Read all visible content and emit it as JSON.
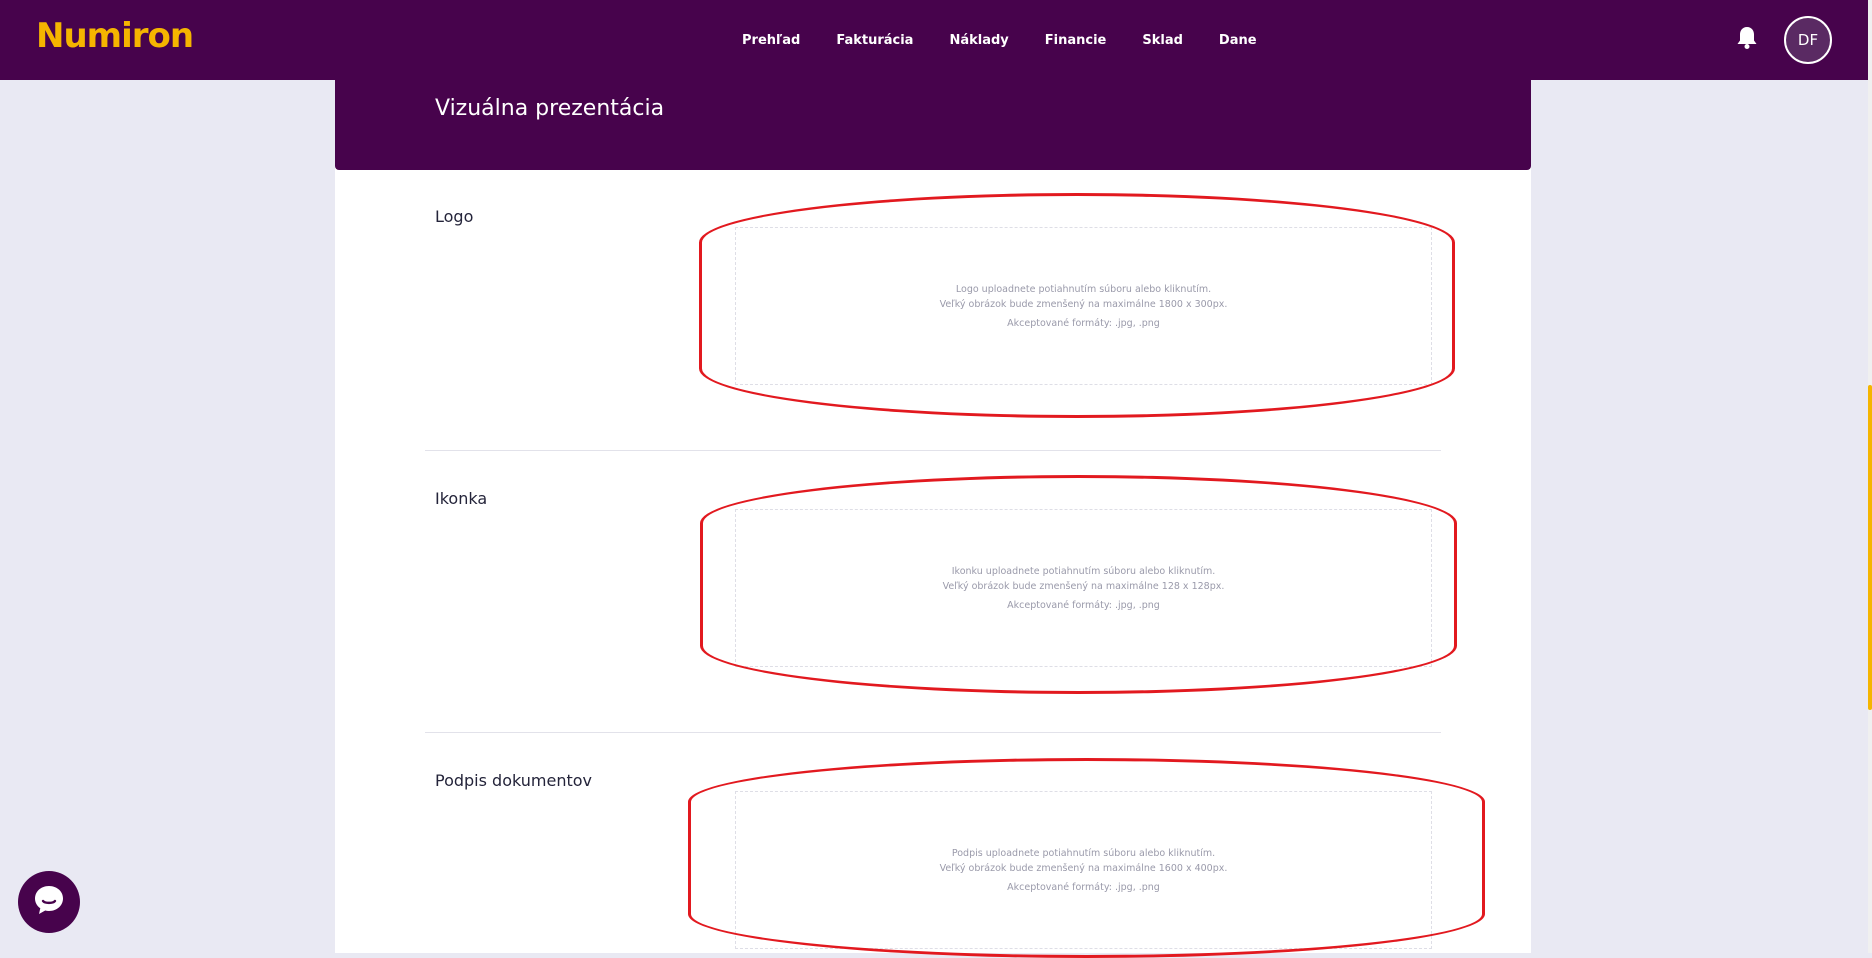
{
  "app": {
    "brand": "Numiron"
  },
  "nav": {
    "items": [
      "Prehľad",
      "Fakturácia",
      "Náklady",
      "Financie",
      "Sklad",
      "Dane"
    ]
  },
  "user": {
    "initials": "DF"
  },
  "section": {
    "title": "Vizuálna prezentácia"
  },
  "uploads": [
    {
      "label": "Logo",
      "line1": "Logo uploadnete potiahnutím súboru alebo kliknutím.",
      "line2": "Veľký obrázok bude zmenšený na maximálne 1800 x 300px.",
      "formats": "Akceptované formáty: .jpg, .png"
    },
    {
      "label": "Ikonka",
      "line1": "Ikonku uploadnete potiahnutím súboru alebo kliknutím.",
      "line2": "Veľký obrázok bude zmenšený na maximálne 128 x 128px.",
      "formats": "Akceptované formáty: .jpg, .png"
    },
    {
      "label": "Podpis dokumentov",
      "line1": "Podpis uploadnete potiahnutím súboru alebo kliknutím.",
      "line2": "Veľký obrázok bude zmenšený na maximálne 1600 x 400px.",
      "formats": "Akceptované formáty: .jpg, .png"
    }
  ],
  "colors": {
    "header_bg": "#47034c",
    "brand": "#f5b500",
    "annotation": "#e2191f",
    "page_bg": "#e9e9f3"
  },
  "icons": [
    "bell-icon",
    "chat-bubble-icon"
  ]
}
